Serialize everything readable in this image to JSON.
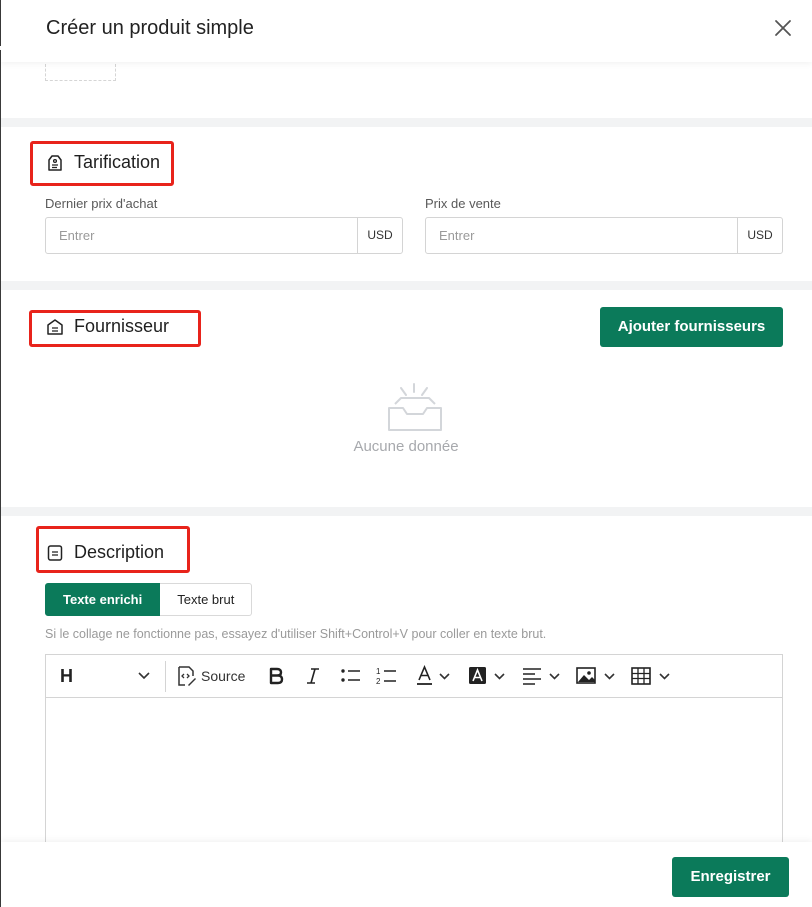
{
  "dialog": {
    "title": "Créer un produit simple",
    "close_icon": "close-icon"
  },
  "pricing": {
    "title": "Tarification",
    "icon": "price-tag-icon",
    "purchase_price": {
      "label": "Dernier prix d'achat",
      "placeholder": "Entrer",
      "currency": "USD"
    },
    "sale_price": {
      "label": "Prix de vente",
      "placeholder": "Entrer",
      "currency": "USD"
    }
  },
  "supplier": {
    "title": "Fournisseur",
    "icon": "supplier-icon",
    "add_button": "Ajouter fournisseurs",
    "empty_icon": "empty-inbox-icon",
    "empty_text": "Aucune donnée"
  },
  "description": {
    "title": "Description",
    "icon": "document-icon",
    "tabs": [
      "Texte enrichi",
      "Texte brut"
    ],
    "active_tab": "Texte enrichi",
    "hint": "Si le collage ne fonctionne pas, essayez d'utiliser Shift+Control+V pour coller en texte brut.",
    "toolbar": {
      "heading": "H",
      "source": "Source",
      "icons": [
        "heading-dropdown-icon",
        "source-code-icon",
        "bold-icon",
        "italic-icon",
        "bulleted-list-icon",
        "numbered-list-icon",
        "font-color-icon",
        "highlight-color-icon",
        "align-icon",
        "image-icon",
        "table-icon"
      ]
    },
    "content": ""
  },
  "footer": {
    "save_button": "Enregistrer"
  },
  "colors": {
    "primary": "#0b7a5a",
    "highlight_border": "#e8231b",
    "section_gap": "#f2f3f4",
    "muted_text": "#9a9a9a"
  }
}
